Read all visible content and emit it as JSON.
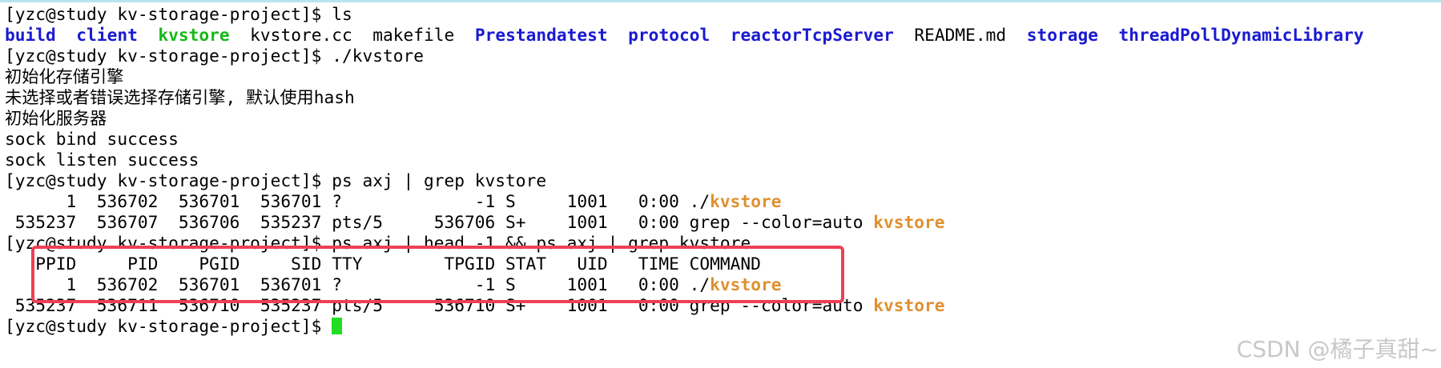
{
  "terminal": {
    "prompt": "[yzc@study kv-storage-project]$ ",
    "lines": [
      {
        "cmd": "ls"
      },
      {
        "items": [
          {
            "text": "build",
            "kind": "dir"
          },
          {
            "text": "client",
            "kind": "dir"
          },
          {
            "text": "kvstore",
            "kind": "exe"
          },
          {
            "text": "kvstore.cc",
            "kind": "file"
          },
          {
            "text": "makefile",
            "kind": "file"
          },
          {
            "text": "Prestandatest",
            "kind": "dir"
          },
          {
            "text": "protocol",
            "kind": "dir"
          },
          {
            "text": "reactorTcpServer",
            "kind": "dir"
          },
          {
            "text": "README.md",
            "kind": "file"
          },
          {
            "text": "storage",
            "kind": "dir"
          },
          {
            "text": "threadPollDynamicLibrary",
            "kind": "dir"
          }
        ]
      },
      {
        "cmd": "./kvstore"
      },
      {
        "text": "初始化存储引擎"
      },
      {
        "text": "未选择或者错误选择存储引擎, 默认使用hash"
      },
      {
        "text": "初始化服务器"
      },
      {
        "text": "sock bind success"
      },
      {
        "text": "sock listen success"
      },
      {
        "cmd": "ps axj | grep kvstore"
      },
      {
        "text": "      1  536702  536701  536701 ?             -1 S     1001   0:00 ./",
        "hl": "kvstore"
      },
      {
        "text": " 535237  536707  536706  535237 pts/5     536706 S+    1001   0:00 grep --color=auto ",
        "hl": "kvstore"
      },
      {
        "cmd": "ps axj | head -1 && ps axj | grep kvstore"
      },
      {
        "text": "   PPID     PID    PGID     SID TTY        TPGID STAT   UID   TIME COMMAND"
      },
      {
        "text": "      1  536702  536701  536701 ?             -1 S     1001   0:00 ./",
        "hl": "kvstore"
      },
      {
        "text": " 535237  536711  536710  535237 pts/5     536710 S+    1001   0:00 grep --color=auto ",
        "hl": "kvstore"
      },
      {
        "cmd": "",
        "cursor": true
      }
    ]
  },
  "colors": {
    "dir": "#1a1ad0",
    "exe": "#18b818",
    "highlight": "#e09030",
    "cursor": "#22dd22",
    "annotation_box": "#ef3f55"
  },
  "watermark": "CSDN @橘子真甜~"
}
